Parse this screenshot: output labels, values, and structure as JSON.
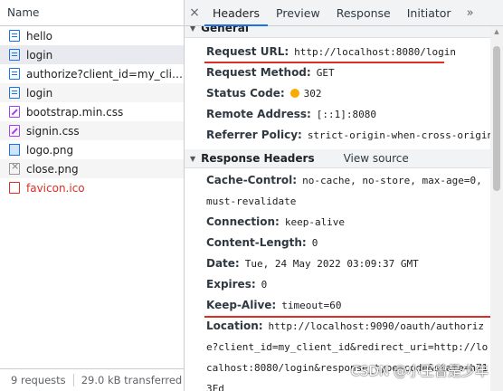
{
  "network_panel": {
    "name_column_header": "Name",
    "requests": [
      {
        "name": "hello",
        "icon": "document-icon",
        "error": false
      },
      {
        "name": "login",
        "icon": "document-icon",
        "error": false
      },
      {
        "name": "authorize?client_id=my_client...",
        "icon": "document-icon",
        "error": false
      },
      {
        "name": "login",
        "icon": "document-icon",
        "error": false
      },
      {
        "name": "bootstrap.min.css",
        "icon": "stylesheet-icon",
        "error": false
      },
      {
        "name": "signin.css",
        "icon": "stylesheet-icon",
        "error": false
      },
      {
        "name": "logo.png",
        "icon": "image-icon",
        "error": false
      },
      {
        "name": "close.png",
        "icon": "image-icon",
        "error": false
      },
      {
        "name": "favicon.ico",
        "icon": "error-document-icon",
        "error": true
      }
    ],
    "footer": {
      "requests_count": "9 requests",
      "transferred": "29.0 kB transferred"
    }
  },
  "detail_tabs": {
    "close": "×",
    "items": [
      "Headers",
      "Preview",
      "Response",
      "Initiator"
    ],
    "active": "Headers",
    "more": "»"
  },
  "general": {
    "title": "General",
    "request_url_key": "Request URL:",
    "request_url_val": "http://localhost:8080/login",
    "request_method_key": "Request Method:",
    "request_method_val": "GET",
    "status_code_key": "Status Code:",
    "status_code_val": "302",
    "remote_address_key": "Remote Address:",
    "remote_address_val": "[::1]:8080",
    "referrer_policy_key": "Referrer Policy:",
    "referrer_policy_val": "strict-origin-when-cross-origin"
  },
  "response_headers": {
    "title": "Response Headers",
    "view_source": "View source",
    "cache_control_key": "Cache-Control:",
    "cache_control_val": "no-cache, no-store, max-age=0, must-revalidate",
    "connection_key": "Connection:",
    "connection_val": "keep-alive",
    "content_length_key": "Content-Length:",
    "content_length_val": "0",
    "date_key": "Date:",
    "date_val": "Tue, 24 May 2022 03:09:37 GMT",
    "expires_key": "Expires:",
    "expires_val": "0",
    "keep_alive_key": "Keep-Alive:",
    "keep_alive_val": "timeout=60",
    "location_key": "Location:",
    "location_val": "http://localhost:9090/oauth/authorize?client_id=my_client_id&redirect_uri=http://localhost:8080/login&response_type=code&state=h713Fd"
  },
  "watermark": "CSDN @小王曾是少年",
  "colors": {
    "accent": "#1a73e8",
    "error": "#d93025",
    "highlight_underline": "#d93025",
    "status_dot": "#f9ab00"
  }
}
